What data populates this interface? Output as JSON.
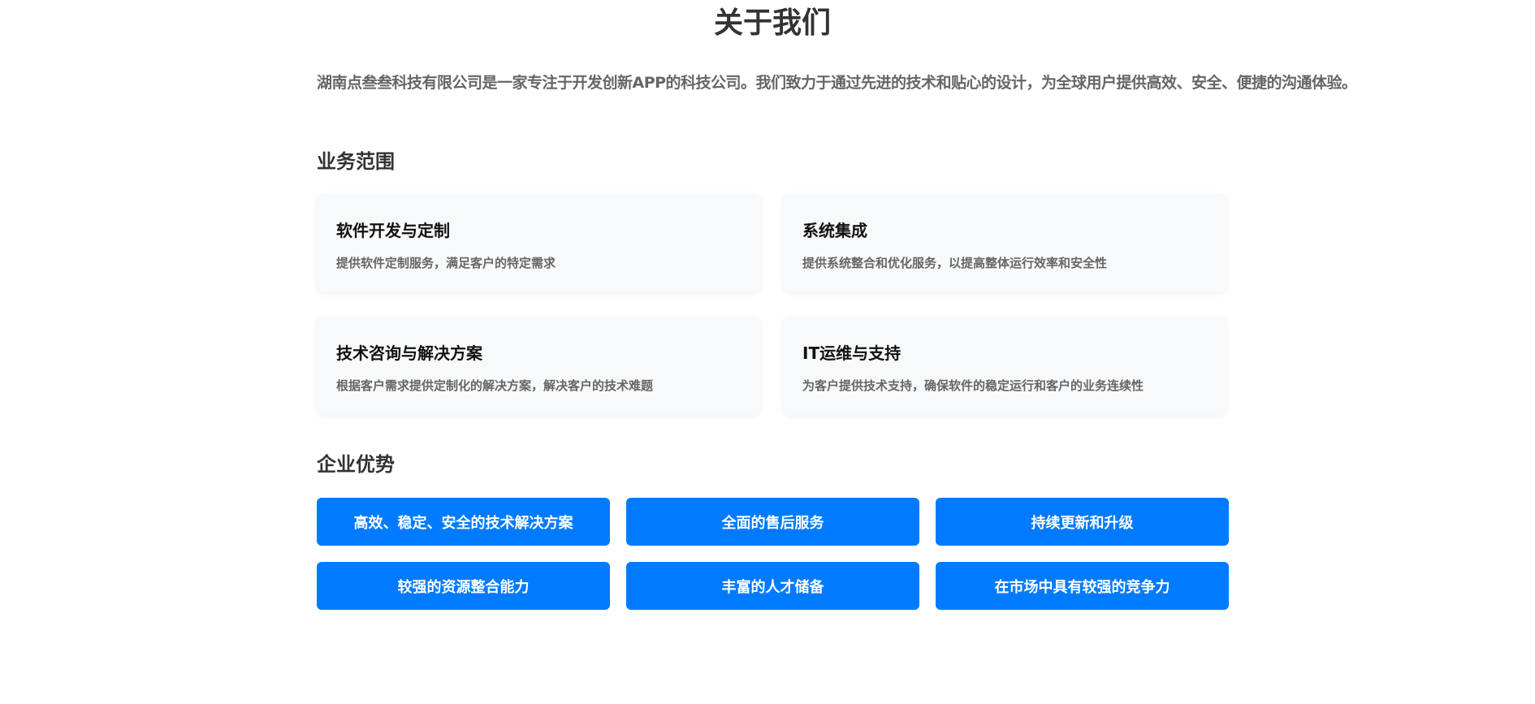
{
  "page": {
    "title": "关于我们",
    "intro": "湖南点叁叁科技有限公司是一家专注于开发创新APP的科技公司。我们致力于通过先进的技术和贴心的设计，为全球用户提供高效、安全、便捷的沟通体验。"
  },
  "business": {
    "title": "业务范围",
    "cards": [
      {
        "title": "软件开发与定制",
        "desc": "提供软件定制服务，满足客户的特定需求"
      },
      {
        "title": "系统集成",
        "desc": "提供系统整合和优化服务，以提高整体运行效率和安全性"
      },
      {
        "title": "技术咨询与解决方案",
        "desc": "根据客户需求提供定制化的解决方案，解决客户的技术难题"
      },
      {
        "title": "IT运维与支持",
        "desc": "为客户提供技术支持，确保软件的稳定运行和客户的业务连续性"
      }
    ]
  },
  "advantages": {
    "title": "企业优势",
    "items": [
      "高效、稳定、安全的技术解决方案",
      "全面的售后服务",
      "持续更新和升级",
      "较强的资源整合能力",
      "丰富的人才储备",
      "在市场中具有较强的竞争力"
    ]
  },
  "colors": {
    "accent": "#007bff",
    "card_bg": "#f8f9fa",
    "heading": "#333333",
    "muted": "#666666"
  }
}
